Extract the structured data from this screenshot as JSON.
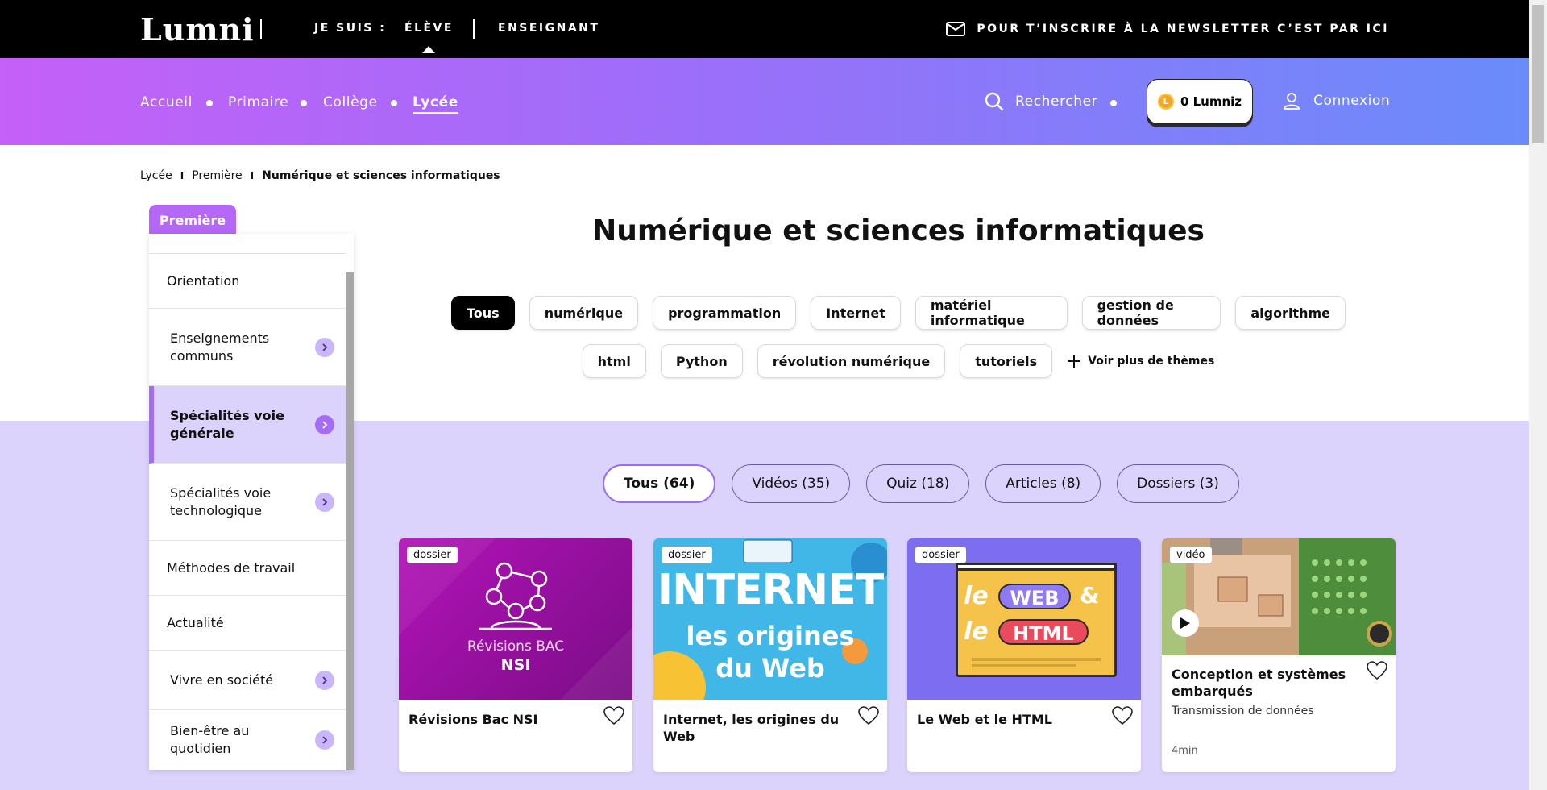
{
  "topbar": {
    "logo": "Lumni",
    "je_suis": "JE SUIS :",
    "eleve": "ÉLÈVE",
    "enseignant": "ENSEIGNANT",
    "newsletter": "POUR T’INSCRIRE À LA NEWSLETTER C’EST PAR ICI"
  },
  "nav": {
    "items": [
      "Accueil",
      "Primaire",
      "Collège",
      "Lycée"
    ],
    "active": "Lycée",
    "search": "Rechercher",
    "lumniz": "0 Lumniz",
    "coin_icon": "L",
    "login": "Connexion"
  },
  "breadcrumb": [
    "Lycée",
    "Première",
    "Numérique et sciences informatiques"
  ],
  "sidebar": {
    "tab": "Première",
    "items": [
      {
        "label": "Orientation",
        "has_arrow": false
      },
      {
        "label": "Enseignements communs",
        "has_arrow": true
      },
      {
        "label": "Spécialités voie générale",
        "has_arrow": true,
        "active": true
      },
      {
        "label": "Spécialités voie technologique",
        "has_arrow": true
      },
      {
        "label": "Méthodes de travail",
        "has_arrow": false
      },
      {
        "label": "Actualité",
        "has_arrow": false
      },
      {
        "label": "Vivre en société",
        "has_arrow": true
      },
      {
        "label": "Bien-être au quotidien",
        "has_arrow": true
      }
    ]
  },
  "main": {
    "title": "Numérique et sciences informatiques",
    "themes_row1": [
      "Tous",
      "numérique",
      "programmation",
      "Internet",
      "matériel informatique",
      "gestion de données",
      "algorithme"
    ],
    "themes_row2": [
      "html",
      "Python",
      "révolution numérique",
      "tutoriels"
    ],
    "more_themes": "Voir plus de thèmes",
    "filters": [
      "Tous (64)",
      "Vidéos (35)",
      "Quiz (18)",
      "Articles (8)",
      "Dossiers (3)"
    ]
  },
  "cards": [
    {
      "tag": "dossier",
      "title": "Révisions Bac NSI",
      "thumb_line1": "Révisions BAC",
      "thumb_line2": "NSI"
    },
    {
      "tag": "dossier",
      "title": "Internet, les origines du Web",
      "thumb_line1": "INTERNET",
      "thumb_line2": "les origines",
      "thumb_line3": "du Web"
    },
    {
      "tag": "dossier",
      "title": "Le Web et le HTML",
      "thumb_line1": "le",
      "thumb_line2": "WEB",
      "thumb_line3": "&",
      "thumb_line4": "le",
      "thumb_line5": "HTML"
    },
    {
      "tag": "vidéo",
      "title": "Conception et systèmes embarqués",
      "subtitle": "Transmission de données",
      "duration": "4min"
    }
  ],
  "colors": {
    "accent_purple": "#a56cf6",
    "lavender_bg": "#dcd3fc",
    "nav_gradient_start": "#c560f8",
    "nav_gradient_end": "#6a8cfa"
  }
}
